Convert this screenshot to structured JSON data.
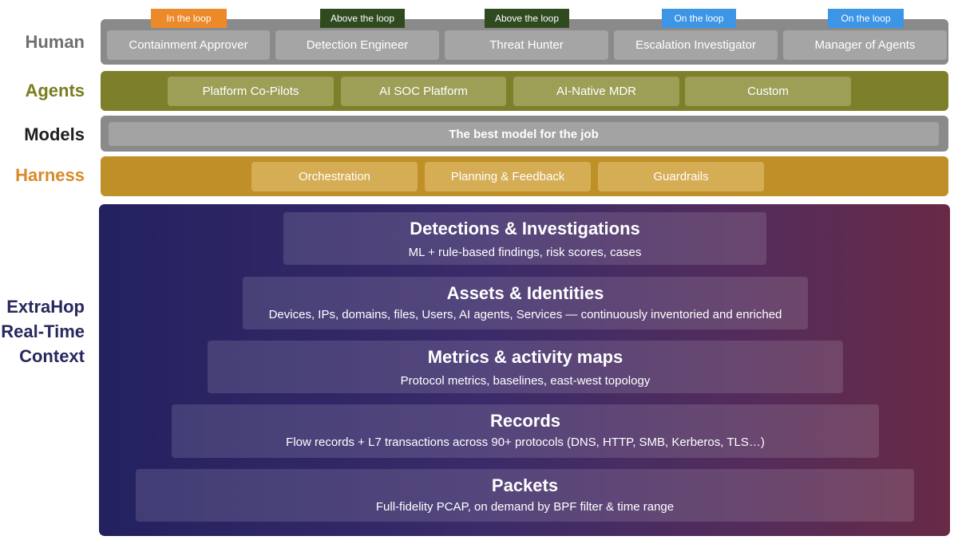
{
  "labels": {
    "human": "Human",
    "agents": "Agents",
    "models": "Models",
    "harness": "Harness",
    "context": [
      "ExtraHop",
      "Real-Time",
      "Context"
    ]
  },
  "human": {
    "roles": [
      {
        "label": "Containment Approver",
        "tag": "In the loop"
      },
      {
        "label": "Detection Engineer",
        "tag": "Above the loop"
      },
      {
        "label": "Threat Hunter",
        "tag": "Above the loop"
      },
      {
        "label": "Escalation Investigator",
        "tag": "On the loop"
      },
      {
        "label": "Manager of Agents",
        "tag": "On the loop"
      }
    ]
  },
  "agents": {
    "items": [
      "Platform Co-Pilots",
      "AI SOC Platform",
      "AI-Native MDR",
      "Custom"
    ]
  },
  "models": {
    "bar": "The best model for the job"
  },
  "harness": {
    "items": [
      "Orchestration",
      "Planning & Feedback",
      "Guardrails"
    ]
  },
  "context": {
    "layers": [
      {
        "title": "Detections & Investigations",
        "subtitle": "ML + rule-based findings, risk scores, cases"
      },
      {
        "title": "Assets & Identities",
        "subtitle": "Devices, IPs, domains, files, Users, AI agents, Services  — continuously inventoried and enriched"
      },
      {
        "title": "Metrics & activity maps",
        "subtitle": "Protocol metrics, baselines, east-west topology"
      },
      {
        "title": "Records",
        "subtitle": "Flow records + L7 transactions across 90+ protocols (DNS, HTTP, SMB, Kerberos, TLS…)"
      },
      {
        "title": "Packets",
        "subtitle": "Full-fidelity PCAP, on demand by BPF filter & time range"
      }
    ]
  },
  "colors": {
    "tag_in_loop": "#ec8a2a",
    "tag_above_loop": "#2f4a1f",
    "tag_on_loop": "#3d95e6",
    "agents_band": "#7d7f2a",
    "harness_band": "#bf9027",
    "context_gradient_start": "#232160",
    "context_gradient_end": "#682a46"
  }
}
